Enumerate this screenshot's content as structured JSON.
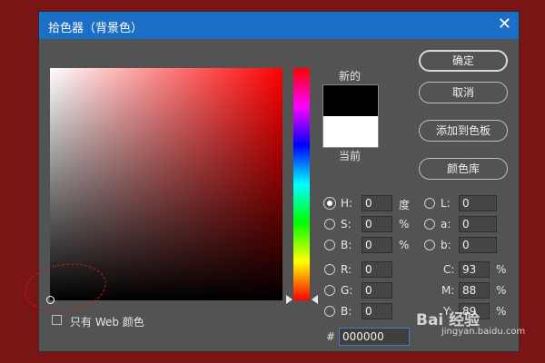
{
  "dialog": {
    "title": "拾色器（背景色）",
    "close_glyph": "✕"
  },
  "preview": {
    "new_label": "新的",
    "current_label": "当前",
    "new_color": "#000000",
    "current_color": "#ffffff"
  },
  "buttons": {
    "ok": "确定",
    "cancel": "取消",
    "add_to_swatches": "添加到色板",
    "color_libraries": "颜色库"
  },
  "hsb": {
    "h": {
      "label": "H:",
      "value": "0",
      "unit": "度",
      "selected": true
    },
    "s": {
      "label": "S:",
      "value": "0",
      "unit": "%"
    },
    "b": {
      "label": "B:",
      "value": "0",
      "unit": "%"
    }
  },
  "rgb": {
    "r": {
      "label": "R:",
      "value": "0"
    },
    "g": {
      "label": "G:",
      "value": "0"
    },
    "b": {
      "label": "B:",
      "value": "0"
    }
  },
  "lab": {
    "l": {
      "label": "L:",
      "value": "0"
    },
    "a": {
      "label": "a:",
      "value": "0"
    },
    "b": {
      "label": "b:",
      "value": "0"
    }
  },
  "cmyk": {
    "c": {
      "label": "C:",
      "value": "93",
      "unit": "%"
    },
    "m": {
      "label": "M:",
      "value": "88",
      "unit": "%"
    },
    "y": {
      "label": "Y:",
      "value": "89",
      "unit": "%"
    }
  },
  "web_only": {
    "label": "只有 Web 颜色",
    "checked": false
  },
  "hex": {
    "label": "#",
    "value": "000000"
  },
  "watermark": {
    "brand": "Bai 经验",
    "url": "jingyan.baidu.com"
  },
  "colors": {
    "titlebar": "#1c6fc6",
    "dialog_bg": "#535353",
    "desktop_bg": "#7a1515",
    "field_hue": "#ff0000"
  }
}
